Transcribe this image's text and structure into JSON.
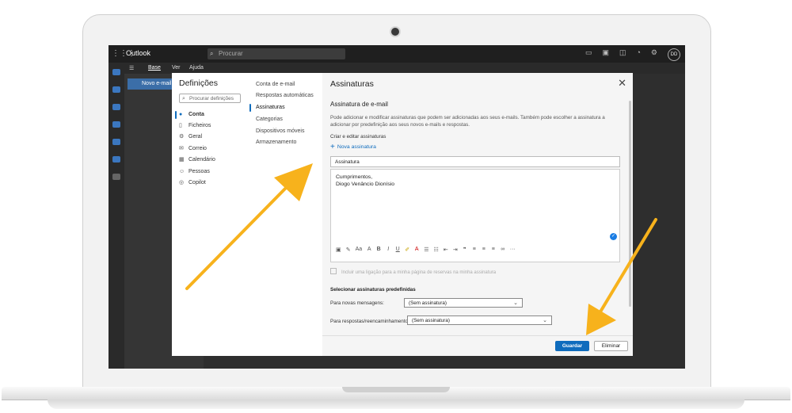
{
  "app": {
    "name": "Outlook",
    "search_placeholder": "Procurar",
    "avatar_initials": "DD",
    "ribbon_tabs": [
      "Base",
      "Ver",
      "Ajuda"
    ],
    "new_mail_label": "Novo e-mail"
  },
  "settings": {
    "title": "Definições",
    "search_placeholder": "Procurar definições",
    "categories": [
      {
        "label": "Conta",
        "icon": "person-icon"
      },
      {
        "label": "Ficheiros",
        "icon": "file-icon"
      },
      {
        "label": "Geral",
        "icon": "gear-icon"
      },
      {
        "label": "Correio",
        "icon": "mail-icon"
      },
      {
        "label": "Calendário",
        "icon": "calendar-icon"
      },
      {
        "label": "Pessoas",
        "icon": "people-icon"
      },
      {
        "label": "Copilot",
        "icon": "copilot-icon"
      }
    ],
    "subcategories": [
      "Conta de e-mail",
      "Respostas automáticas",
      "Assinaturas",
      "Categorias",
      "Dispositivos móveis",
      "Armazenamento"
    ]
  },
  "signatures": {
    "title": "Assinaturas",
    "section_title": "Assinatura de e-mail",
    "description": "Pode adicionar e modificar assinaturas que podem ser adicionadas aos seus e-mails. Também pode escolher a assinatura a adicionar por predefinição aos seus novos e-mails e respostas.",
    "create_label": "Criar e editar assinaturas",
    "new_signature": "Nova assinatura",
    "name_value": "Assinatura",
    "body_lines": [
      "Cumprimentos,",
      "Diogo Venâncio Dionísio"
    ],
    "booking_checkbox": "Incluir uma ligação para a minha página de reservas na minha assinatura",
    "defaults_title": "Selecionar assinaturas predefinidas",
    "new_messages_label": "Para novas mensagens:",
    "new_messages_value": "(Sem assinatura)",
    "replies_label": "Para respostas/reencaminhamentos:",
    "replies_value": "(Sem assinatura)",
    "save_button": "Guardar",
    "discard_button": "Eliminar"
  },
  "colors": {
    "accent": "#0f6cbd",
    "arrow": "#f7b21c"
  }
}
